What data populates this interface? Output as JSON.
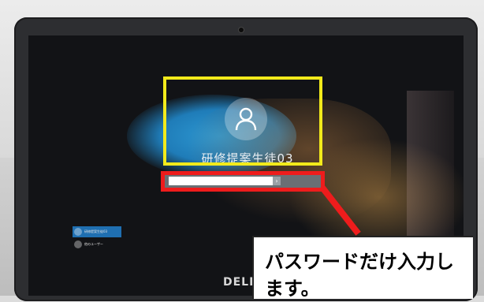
{
  "login": {
    "username": "研修提案生徒03",
    "password_value": "",
    "submit_icon": "arrow-right-icon"
  },
  "user_list": [
    {
      "label": "研修提案生徒03",
      "active": true
    },
    {
      "label": "他のユーザー",
      "active": false
    }
  ],
  "brand": "DELL",
  "callout": {
    "text": "パスワードだけ入力します。"
  },
  "colors": {
    "highlight_yellow": "#f2ea1b",
    "highlight_red": "#ee1c1c",
    "windows_blue": "#2e9ad4"
  }
}
